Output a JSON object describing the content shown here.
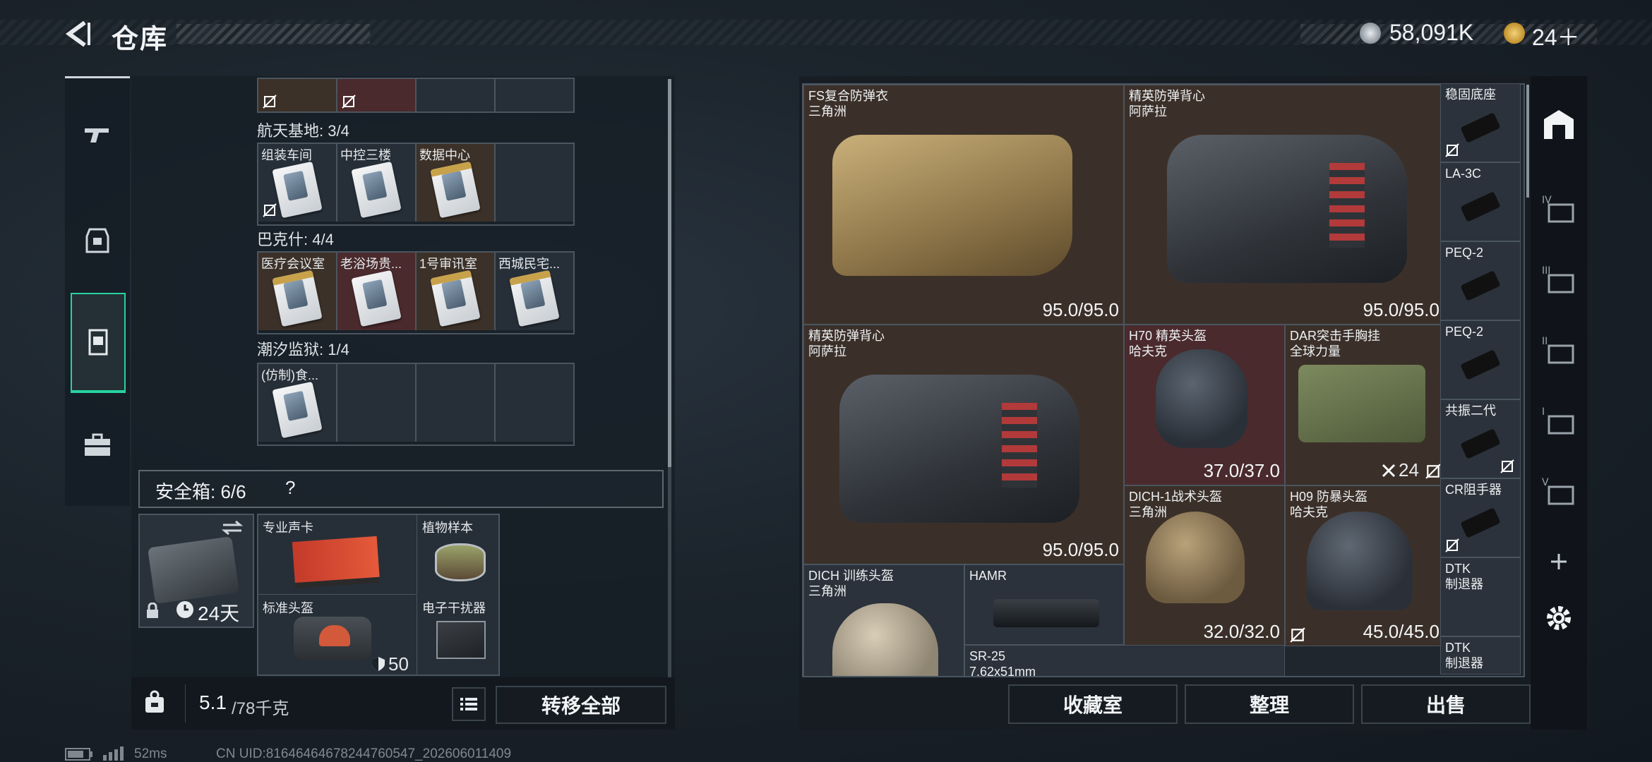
{
  "header": {
    "title": "仓库",
    "currency_1": "58,091K",
    "currency_2": "24＋"
  },
  "left": {
    "top_partial_row": [
      "",
      "",
      "",
      ""
    ],
    "groups": [
      {
        "label": "航天基地: 3/4",
        "items": [
          "组装车间",
          "中控三楼",
          "数据中心",
          ""
        ]
      },
      {
        "label": "巴克什: 4/4",
        "items": [
          "医疗会议室",
          "老浴场贵...",
          "1号审讯室",
          "西城民宅..."
        ]
      },
      {
        "label": "潮汐监狱: 1/4",
        "items": [
          "(仿制)食...",
          "",
          "",
          ""
        ]
      }
    ],
    "safe": {
      "label": "安全箱: 6/6",
      "help": "?",
      "days": "24天",
      "items": [
        {
          "name": "专业声卡"
        },
        {
          "name": "植物样本"
        },
        {
          "name": "标准头盔",
          "count": "50"
        },
        {
          "name": "电子干扰器"
        }
      ]
    },
    "weight": "5.1",
    "weight_cap": "/78千克",
    "transfer_all": "转移全部"
  },
  "right": {
    "items": [
      {
        "name": "FS复合防弹衣",
        "sub": "三角洲",
        "durability": "95.0/95.0"
      },
      {
        "name": "精英防弹背心",
        "sub": "阿萨拉",
        "durability": "95.0/95.0"
      },
      {
        "name": "精英防弹背心",
        "sub": "阿萨拉",
        "durability": "95.0/95.0"
      },
      {
        "name": "H70 精英头盔",
        "sub": "哈夫克",
        "durability": "37.0/37.0"
      },
      {
        "name": "DAR突击手胸挂",
        "sub": "全球力量",
        "count": "24"
      },
      {
        "name": "DICH-1战术头盔",
        "sub": "三角洲",
        "durability": "32.0/32.0"
      },
      {
        "name": "H09 防暴头盔",
        "sub": "哈夫克",
        "durability": "45.0/45.0"
      },
      {
        "name": "DICH 训练头盔",
        "sub": "三角洲"
      },
      {
        "name": "HAMR"
      },
      {
        "name": "SR-25",
        "sub": "7.62x51mm"
      }
    ],
    "side_items": [
      "稳固底座",
      "LA-3C",
      "PEQ-2",
      "PEQ-2",
      "共振二代",
      "CR阻手器",
      "DTK",
      "DTK"
    ],
    "side_items_sub": [
      "",
      "",
      "",
      "",
      "",
      "",
      "制退器",
      "制退器"
    ],
    "buttons": {
      "collection": "收藏室",
      "organize": "整理",
      "sell": "出售"
    }
  },
  "status": {
    "ping": "52ms",
    "uid": "CN UID:81646464678244760547_202606011409"
  },
  "colors": {
    "accent": "#27d3a0",
    "item_brown": "#3b3029",
    "item_red": "#4a2a2d"
  }
}
